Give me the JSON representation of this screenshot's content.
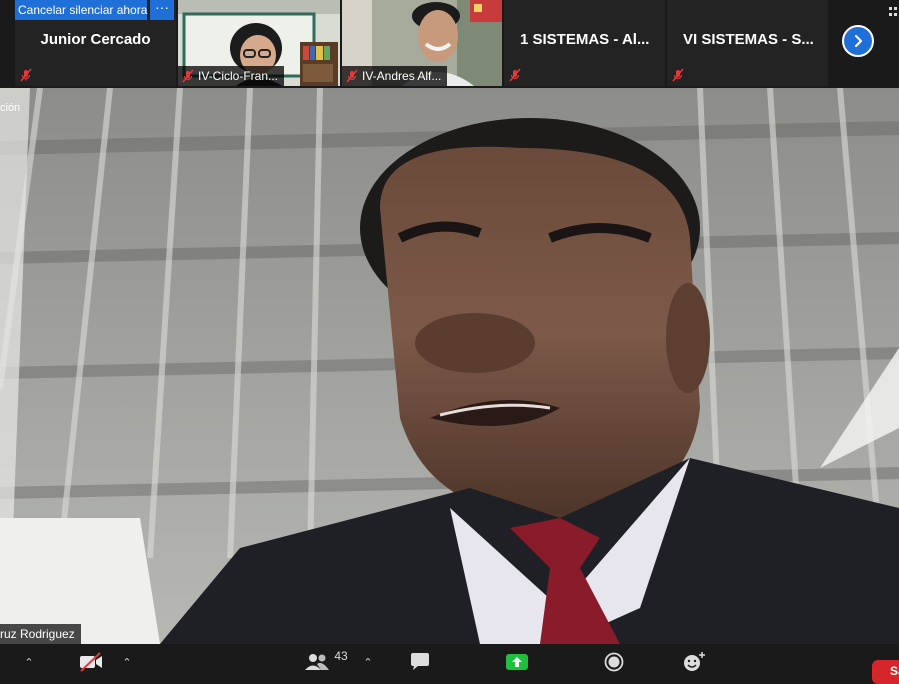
{
  "banner": {
    "unmute_label": "Cancelar silenciar ahora",
    "more_label": "···"
  },
  "participants": [
    {
      "name": "Junior Cercado",
      "display": "name"
    },
    {
      "name": "IV-Ciclo-Fran...",
      "display": "video"
    },
    {
      "name": "IV-Andres Alf...",
      "display": "video"
    },
    {
      "name": "1 SISTEMAS - Al...",
      "display": "name"
    },
    {
      "name": "VI SISTEMAS - S...",
      "display": "name"
    }
  ],
  "main_speaker": {
    "name": "ruz Rodriguez",
    "edge_caption": "ción"
  },
  "toolbar": {
    "participants_count": "43",
    "leave_label": "Sa"
  },
  "colors": {
    "accent": "#1f6fd8",
    "muted": "#e5383b",
    "share": "#1ec13d",
    "leave": "#d5262c"
  }
}
